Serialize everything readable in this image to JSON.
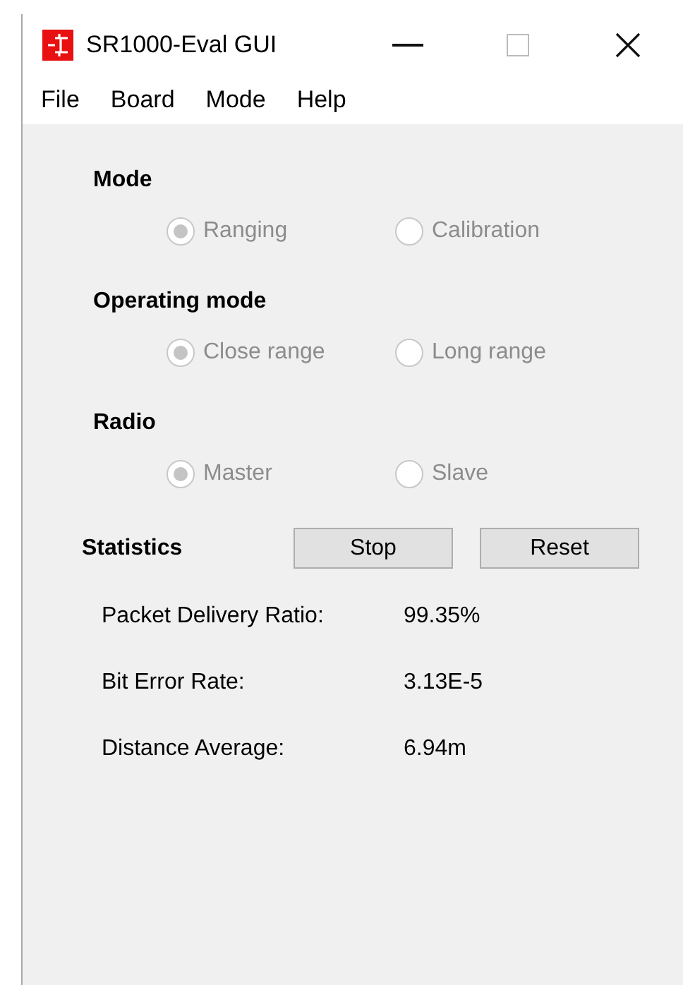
{
  "window": {
    "title": "SR1000-Eval GUI"
  },
  "menu": [
    "File",
    "Board",
    "Mode",
    "Help"
  ],
  "groups": [
    {
      "title": "Mode",
      "disabled": true,
      "options": [
        {
          "label": "Ranging",
          "selected": true
        },
        {
          "label": "Calibration",
          "selected": false
        }
      ]
    },
    {
      "title": "Operating mode",
      "disabled": true,
      "options": [
        {
          "label": "Close range",
          "selected": true
        },
        {
          "label": "Long range",
          "selected": false
        }
      ]
    },
    {
      "title": "Radio",
      "disabled": true,
      "options": [
        {
          "label": "Master",
          "selected": true
        },
        {
          "label": "Slave",
          "selected": false
        }
      ]
    }
  ],
  "statistics": {
    "title": "Statistics",
    "buttons": [
      "Stop",
      "Reset"
    ],
    "rows": [
      {
        "label": "Packet Delivery Ratio:",
        "value": "99.35%"
      },
      {
        "label": "Bit Error Rate:",
        "value": "3.13E-5"
      },
      {
        "label": "Distance Average:",
        "value": "6.94m"
      }
    ]
  }
}
